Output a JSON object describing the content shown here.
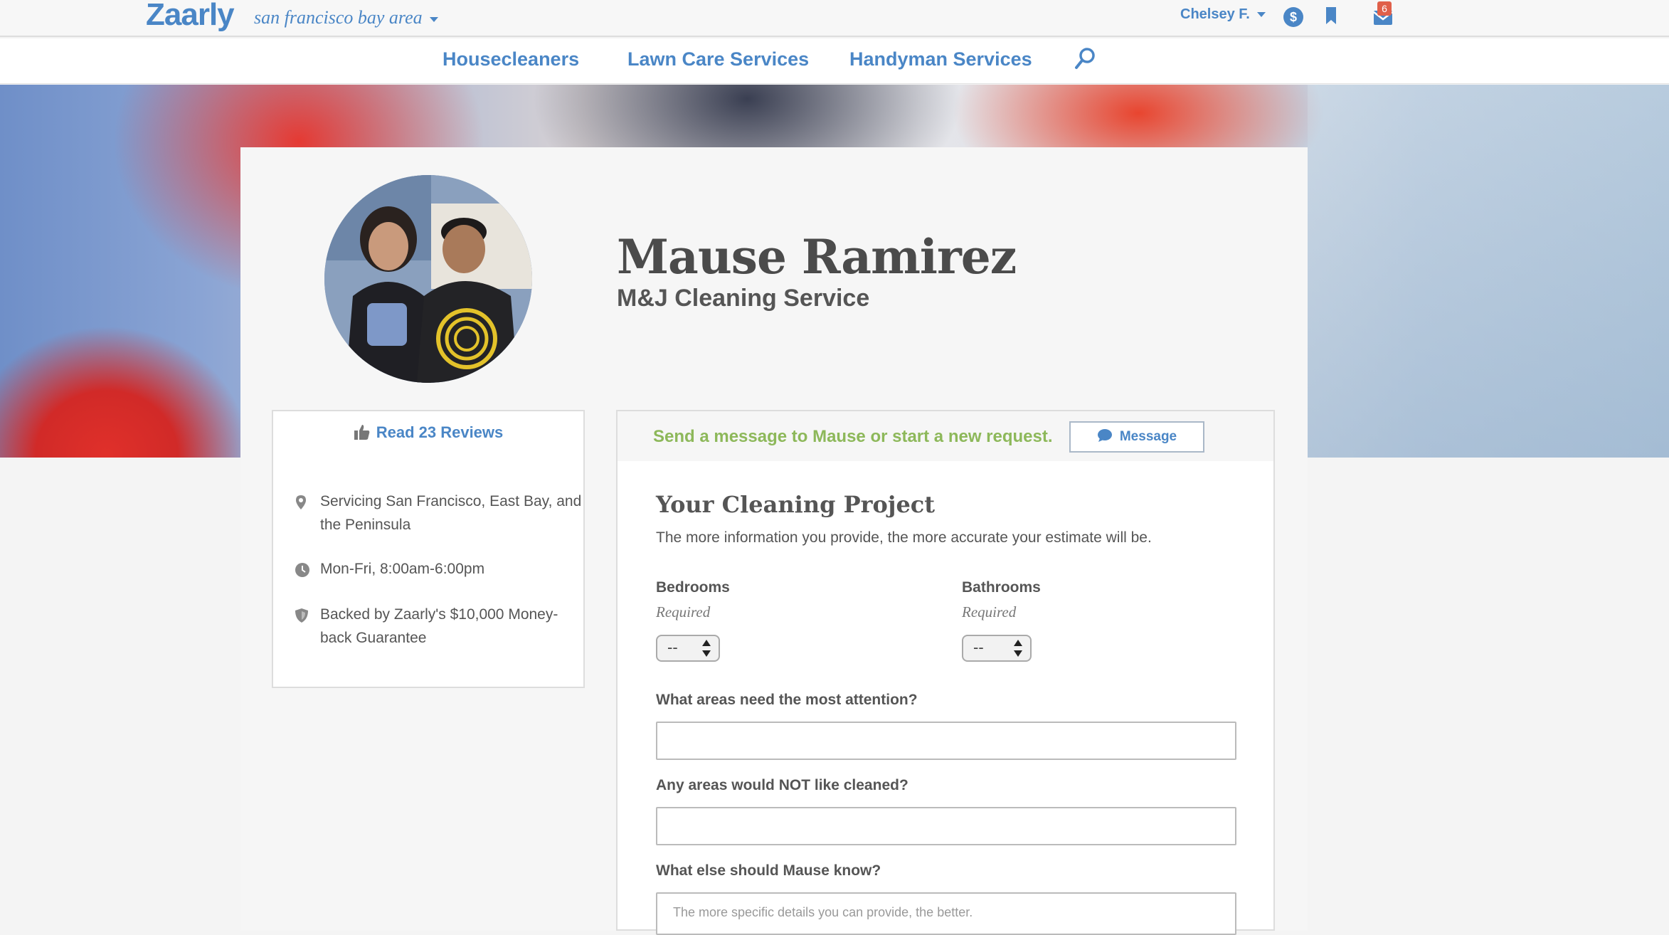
{
  "header": {
    "logo": "Zaarly",
    "location": "san francisco bay area",
    "user": "Chelsey F.",
    "dollar_icon": "$",
    "mail_badge": "6"
  },
  "nav": {
    "categories": [
      "Housecleaners",
      "Lawn Care Services",
      "Handyman Services"
    ]
  },
  "profile": {
    "name": "Mause Ramirez",
    "company": "M&J Cleaning Service",
    "reviews_link": "Read 23 Reviews",
    "info": [
      {
        "icon": "location-pin-icon",
        "text": "Servicing San Francisco, East Bay, and the Peninsula"
      },
      {
        "icon": "clock-icon",
        "text": "Mon-Fri, 8:00am-6:00pm"
      },
      {
        "icon": "shield-icon",
        "text": "Backed by Zaarly's $10,000 Money-back Guarantee"
      }
    ]
  },
  "message": {
    "prompt": "Send a message to Mause or start a new request.",
    "button_label": "Message"
  },
  "form": {
    "title": "Your Cleaning Project",
    "subtitle": "The more information you provide, the more accurate your estimate will be.",
    "bedrooms_label": "Bedrooms",
    "bathrooms_label": "Bathrooms",
    "required_label": "Required",
    "stepper_value": "--",
    "attention_label": "What areas need the most attention?",
    "not_cleaned_label": "Any areas would NOT like cleaned?",
    "else_label": "What else should Mause know?",
    "else_placeholder": "The more specific details you can provide, the better."
  },
  "colors": {
    "accent": "#4a86c6",
    "prompt_green": "#8db85a",
    "badge": "#e0604a"
  }
}
